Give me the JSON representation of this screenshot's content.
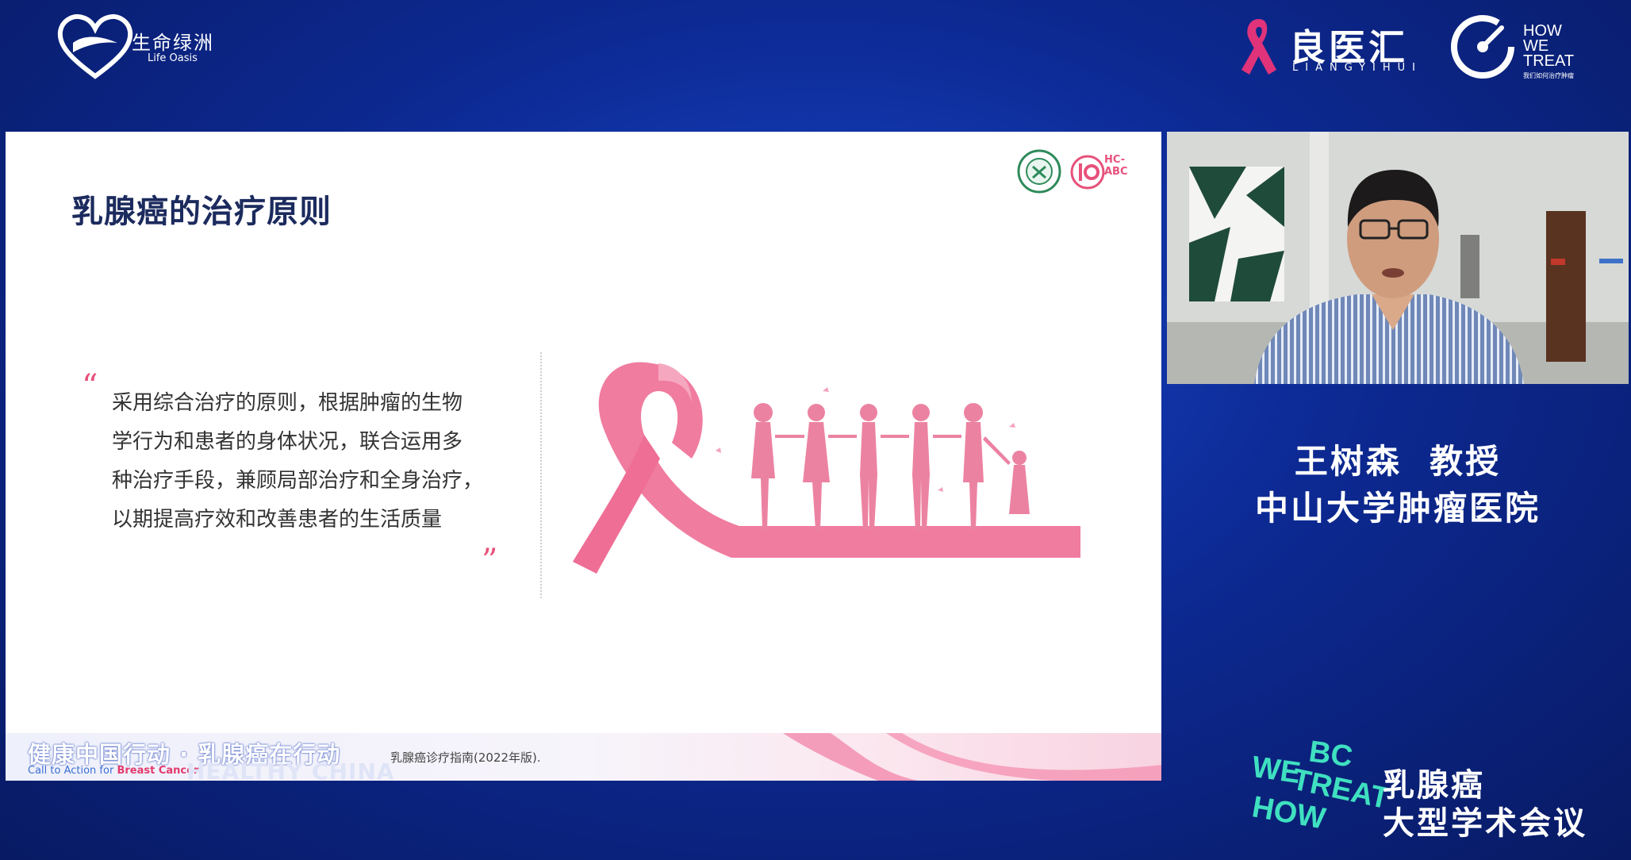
{
  "top_logos": {
    "life_oasis": {
      "cn": "生命绿洲",
      "en": "Life Oasis"
    },
    "liangyihui": {
      "cn": "良医汇",
      "en": "LIANGYIHUI"
    },
    "howwetreat": {
      "line1": "HOW",
      "line2": "WE",
      "line3": "TREAT",
      "sub": "我们如何治疗肿瘤"
    }
  },
  "slide": {
    "title": "乳腺癌的治疗原则",
    "logo_badge": "HC-ABC",
    "quote_open": "“",
    "quote_close": "”",
    "quote_lines": [
      "采用综合治疗的原则，根据肿瘤的生物",
      "学行为和患者的身体状况，联合运用多",
      "种治疗手段，兼顾局部治疗和全身治疗，",
      "以期提高疗效和改善患者的生活质量"
    ],
    "footer": {
      "cn": "健康中国行动 · 乳腺癌在行动",
      "en_prefix": "Call to Action for ",
      "en_highlight": "Breast Cancer",
      "healthy_china": "HEALTHY CHINA",
      "reference": "乳腺癌诊疗指南(2022年版)."
    }
  },
  "speaker": {
    "name": "王树森  教授",
    "org": "中山大学肿瘤医院"
  },
  "conference": {
    "logo_words": [
      "WE",
      "BC",
      "TREAT",
      "HOW"
    ],
    "line1": "乳腺癌",
    "line2": "大型学术会议"
  },
  "colors": {
    "background": "#0d2a94",
    "accent_pink": "#e7517b",
    "ribbon_pink": "#f08aa6",
    "title_navy": "#1c2b5e"
  }
}
